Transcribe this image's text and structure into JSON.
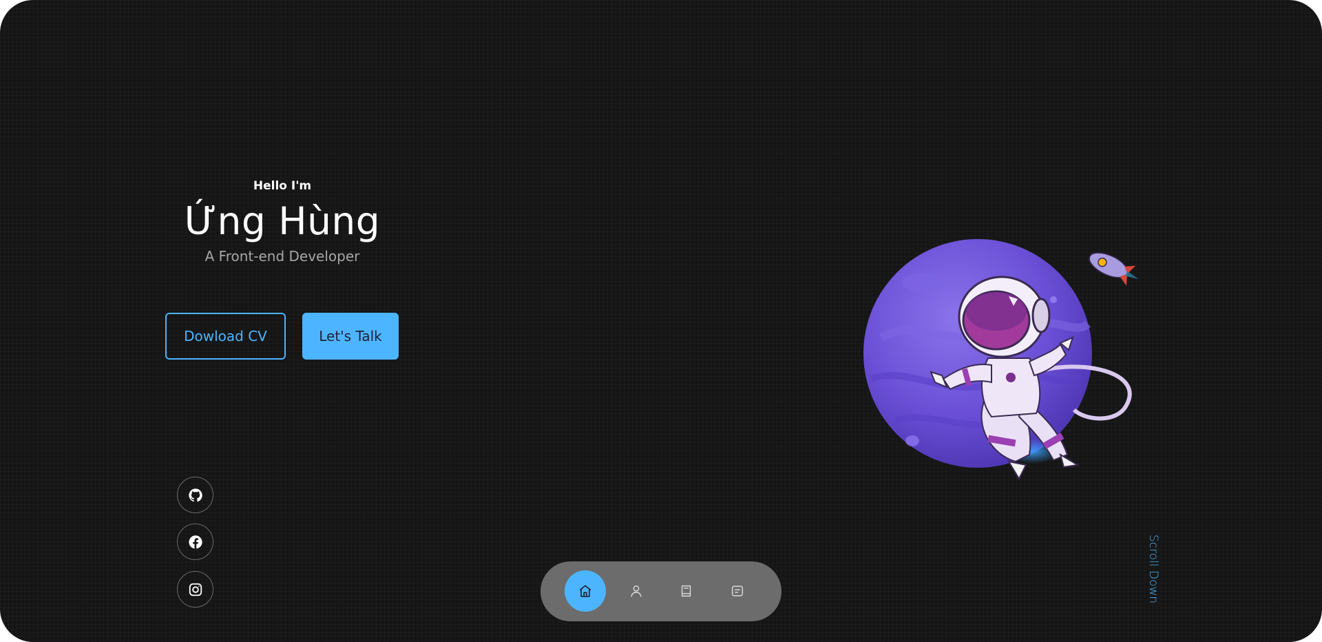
{
  "hero": {
    "greeting": "Hello I'm",
    "name": "Ứng Hùng",
    "role": "A Front-end Developer"
  },
  "buttons": {
    "download_cv": "Dowload CV",
    "lets_talk": "Let's Talk"
  },
  "social": [
    {
      "icon": "github-icon"
    },
    {
      "icon": "facebook-icon"
    },
    {
      "icon": "instagram-icon"
    }
  ],
  "nav": {
    "items": [
      {
        "icon": "home-icon",
        "active": true
      },
      {
        "icon": "user-icon",
        "active": false
      },
      {
        "icon": "book-icon",
        "active": false
      },
      {
        "icon": "message-icon",
        "active": false
      }
    ]
  },
  "scroll_down": "Scroll Down",
  "colors": {
    "background": "#151515",
    "accent": "#4db5ff",
    "nav_bar": "#6c6c6c",
    "planet": "#6a4fd6",
    "text_muted": "#a7a7a7"
  }
}
